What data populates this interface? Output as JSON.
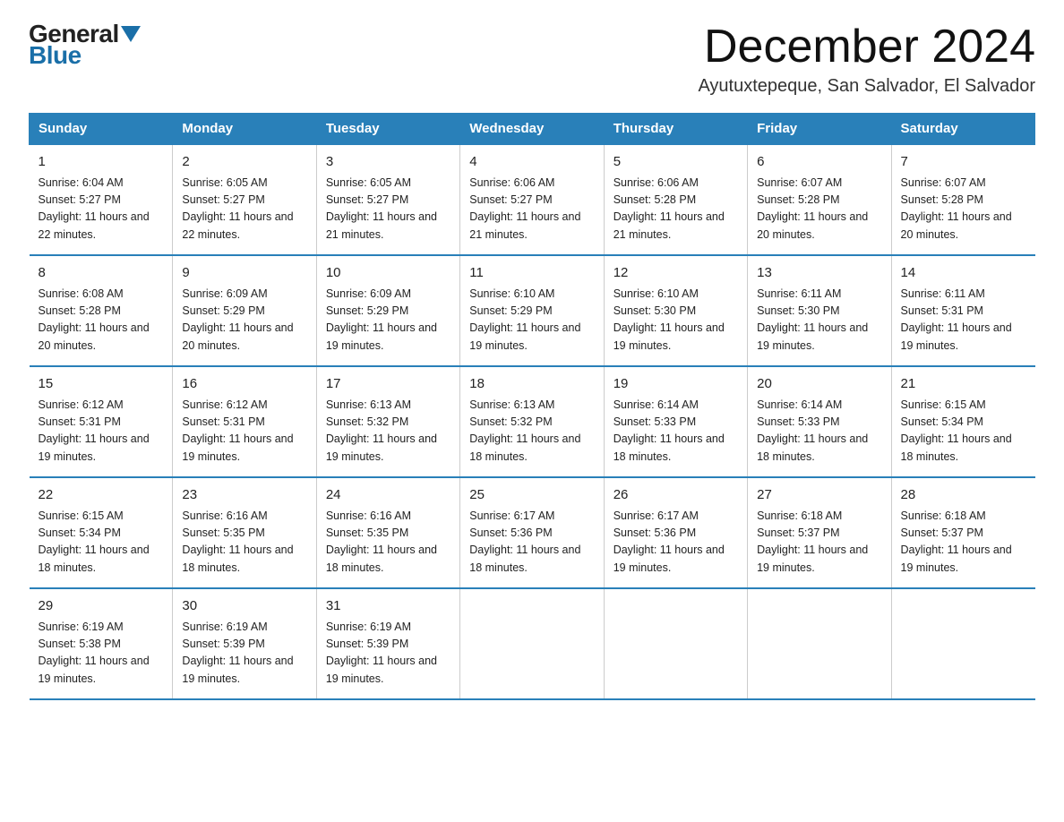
{
  "header": {
    "logo_top": "General",
    "logo_bottom": "Blue",
    "month_year": "December 2024",
    "location": "Ayutuxtepeque, San Salvador, El Salvador"
  },
  "days_of_week": [
    "Sunday",
    "Monday",
    "Tuesday",
    "Wednesday",
    "Thursday",
    "Friday",
    "Saturday"
  ],
  "weeks": [
    [
      {
        "day": "1",
        "sunrise": "6:04 AM",
        "sunset": "5:27 PM",
        "daylight": "11 hours and 22 minutes."
      },
      {
        "day": "2",
        "sunrise": "6:05 AM",
        "sunset": "5:27 PM",
        "daylight": "11 hours and 22 minutes."
      },
      {
        "day": "3",
        "sunrise": "6:05 AM",
        "sunset": "5:27 PM",
        "daylight": "11 hours and 21 minutes."
      },
      {
        "day": "4",
        "sunrise": "6:06 AM",
        "sunset": "5:27 PM",
        "daylight": "11 hours and 21 minutes."
      },
      {
        "day": "5",
        "sunrise": "6:06 AM",
        "sunset": "5:28 PM",
        "daylight": "11 hours and 21 minutes."
      },
      {
        "day": "6",
        "sunrise": "6:07 AM",
        "sunset": "5:28 PM",
        "daylight": "11 hours and 20 minutes."
      },
      {
        "day": "7",
        "sunrise": "6:07 AM",
        "sunset": "5:28 PM",
        "daylight": "11 hours and 20 minutes."
      }
    ],
    [
      {
        "day": "8",
        "sunrise": "6:08 AM",
        "sunset": "5:28 PM",
        "daylight": "11 hours and 20 minutes."
      },
      {
        "day": "9",
        "sunrise": "6:09 AM",
        "sunset": "5:29 PM",
        "daylight": "11 hours and 20 minutes."
      },
      {
        "day": "10",
        "sunrise": "6:09 AM",
        "sunset": "5:29 PM",
        "daylight": "11 hours and 19 minutes."
      },
      {
        "day": "11",
        "sunrise": "6:10 AM",
        "sunset": "5:29 PM",
        "daylight": "11 hours and 19 minutes."
      },
      {
        "day": "12",
        "sunrise": "6:10 AM",
        "sunset": "5:30 PM",
        "daylight": "11 hours and 19 minutes."
      },
      {
        "day": "13",
        "sunrise": "6:11 AM",
        "sunset": "5:30 PM",
        "daylight": "11 hours and 19 minutes."
      },
      {
        "day": "14",
        "sunrise": "6:11 AM",
        "sunset": "5:31 PM",
        "daylight": "11 hours and 19 minutes."
      }
    ],
    [
      {
        "day": "15",
        "sunrise": "6:12 AM",
        "sunset": "5:31 PM",
        "daylight": "11 hours and 19 minutes."
      },
      {
        "day": "16",
        "sunrise": "6:12 AM",
        "sunset": "5:31 PM",
        "daylight": "11 hours and 19 minutes."
      },
      {
        "day": "17",
        "sunrise": "6:13 AM",
        "sunset": "5:32 PM",
        "daylight": "11 hours and 19 minutes."
      },
      {
        "day": "18",
        "sunrise": "6:13 AM",
        "sunset": "5:32 PM",
        "daylight": "11 hours and 18 minutes."
      },
      {
        "day": "19",
        "sunrise": "6:14 AM",
        "sunset": "5:33 PM",
        "daylight": "11 hours and 18 minutes."
      },
      {
        "day": "20",
        "sunrise": "6:14 AM",
        "sunset": "5:33 PM",
        "daylight": "11 hours and 18 minutes."
      },
      {
        "day": "21",
        "sunrise": "6:15 AM",
        "sunset": "5:34 PM",
        "daylight": "11 hours and 18 minutes."
      }
    ],
    [
      {
        "day": "22",
        "sunrise": "6:15 AM",
        "sunset": "5:34 PM",
        "daylight": "11 hours and 18 minutes."
      },
      {
        "day": "23",
        "sunrise": "6:16 AM",
        "sunset": "5:35 PM",
        "daylight": "11 hours and 18 minutes."
      },
      {
        "day": "24",
        "sunrise": "6:16 AM",
        "sunset": "5:35 PM",
        "daylight": "11 hours and 18 minutes."
      },
      {
        "day": "25",
        "sunrise": "6:17 AM",
        "sunset": "5:36 PM",
        "daylight": "11 hours and 18 minutes."
      },
      {
        "day": "26",
        "sunrise": "6:17 AM",
        "sunset": "5:36 PM",
        "daylight": "11 hours and 19 minutes."
      },
      {
        "day": "27",
        "sunrise": "6:18 AM",
        "sunset": "5:37 PM",
        "daylight": "11 hours and 19 minutes."
      },
      {
        "day": "28",
        "sunrise": "6:18 AM",
        "sunset": "5:37 PM",
        "daylight": "11 hours and 19 minutes."
      }
    ],
    [
      {
        "day": "29",
        "sunrise": "6:19 AM",
        "sunset": "5:38 PM",
        "daylight": "11 hours and 19 minutes."
      },
      {
        "day": "30",
        "sunrise": "6:19 AM",
        "sunset": "5:39 PM",
        "daylight": "11 hours and 19 minutes."
      },
      {
        "day": "31",
        "sunrise": "6:19 AM",
        "sunset": "5:39 PM",
        "daylight": "11 hours and 19 minutes."
      },
      null,
      null,
      null,
      null
    ]
  ]
}
